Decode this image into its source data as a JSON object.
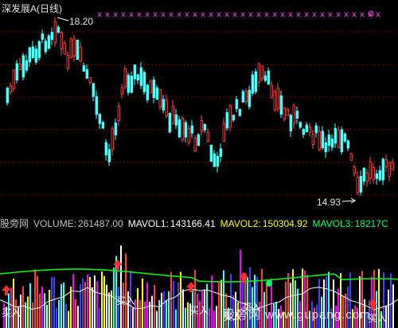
{
  "title": "深发展A(日线)",
  "price_high": "18.20",
  "price_low": "14.93",
  "volume_bar": {
    "source": "股旁网",
    "volume_label": "VOLUME:",
    "volume_value": "261487.00",
    "mavol1_label": "MAVOL1:",
    "mavol1_value": "143166.41",
    "mavol2_label": "MAVOL2:",
    "mavol2_value": "150304.92",
    "mavol3_label": "MAVOL3:",
    "mavol3_value": "18217C"
  },
  "signal_label": "买入",
  "watermark": "股旁网 www.gupang.com",
  "colors": {
    "background": "#000000",
    "grid": "#8b0000",
    "up_candle": "#ff5050",
    "down_candle": "#54ffff",
    "text_volume": "#c0c0c0",
    "mavol1": "#ffffff",
    "mavol2": "#ffff00",
    "mavol3": "#ff00ff",
    "marker": "#ff44ff",
    "signal_arrow": "#ff3030",
    "volume_ma_line": "#00ff00"
  }
}
